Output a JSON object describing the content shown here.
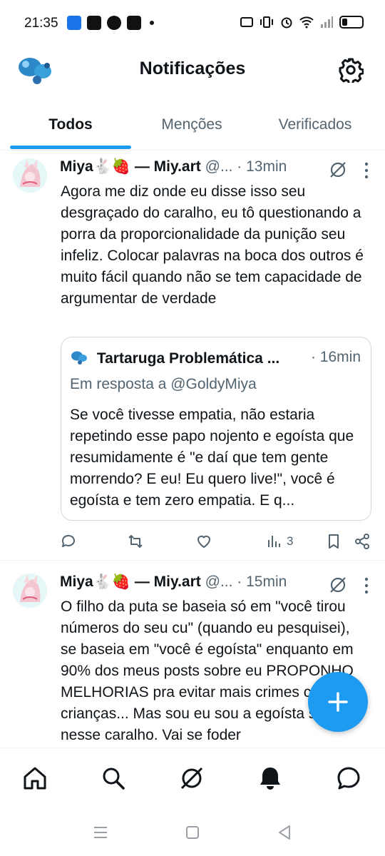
{
  "status_bar": {
    "time": "21:35"
  },
  "header": {
    "title": "Notificações"
  },
  "tabs": [
    {
      "label": "Todos",
      "active": true
    },
    {
      "label": "Menções",
      "active": false
    },
    {
      "label": "Verificados",
      "active": false
    }
  ],
  "posts": [
    {
      "name": "Miya🐇🍓 — Miy.art",
      "handle": "@...",
      "time": "· 13min",
      "text": "Agora me diz onde eu disse isso seu desgraçado do caralho, eu tô questionando a porra da proporcionalidade da punição seu infeliz. Colocar palavras na boca dos outros é muito fácil quando não se tem capacidade de argumentar de verdade",
      "quote": {
        "name": "Tartaruga Problemática ...",
        "time": "· 16min",
        "reply_to": "Em resposta a @GoldyMiya",
        "text": "Se você tivesse empatia, não estaria repetindo esse papo nojento e egoísta que resumidamente é \"e daí que tem gente morrendo? E eu! Eu quero live!\", você é egoísta e tem zero empatia. E q..."
      },
      "views": "3"
    },
    {
      "name": "Miya🐇🍓 — Miy.art",
      "handle": "@...",
      "time": "· 15min",
      "text": "O filho da puta se baseia só em \"você tirou números do seu cu\" (quando eu pesquisei), se baseia em \"você é egoísta\" enquanto em 90% dos meus posts sobre eu PROPONHO MELHORIAS pra evitar mais crimes contra crianças... Mas sou eu sou a egoísta sim nesse caralho. Vai se foder"
    }
  ],
  "colors": {
    "accent": "#1d9bf0",
    "text": "#0f1419",
    "secondary": "#536471"
  }
}
